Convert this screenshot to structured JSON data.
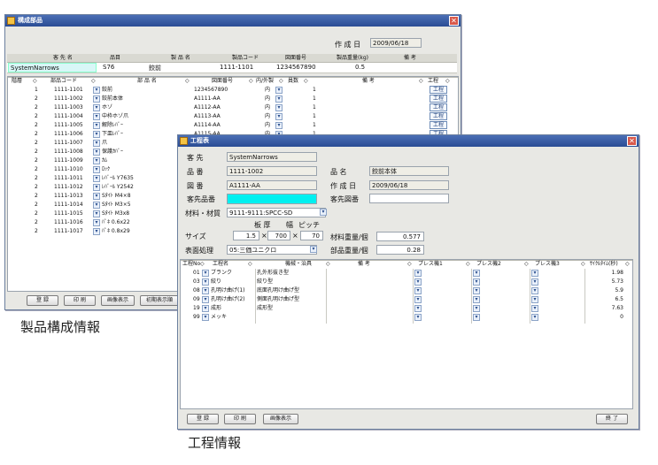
{
  "product_window": {
    "title": "構成部品",
    "created_label": "作 成 日",
    "created_date": "2009/06/18",
    "header_cols": [
      "客 先 名",
      "品目",
      "製 品 名",
      "製品コード",
      "図面番号",
      "製品重量(kg)",
      "備  考"
    ],
    "header_values": {
      "customer": "SystemNarrows",
      "item": "S76",
      "product_name": "鉸前",
      "product_code": "1111-1101",
      "drawing_no": "1234567890",
      "weight": "0.5"
    },
    "table_cols": [
      "階層",
      "部品コード",
      "部 品 名",
      "図面番号",
      "内/外製",
      "員数",
      "備  考",
      "工程"
    ],
    "rows": [
      {
        "level": "1",
        "code": "1111-1101",
        "name": "鉸前",
        "drawing": "1234567890",
        "inout": "内",
        "qty": "1",
        "btn": "工程"
      },
      {
        "level": "2",
        "code": "1111-1002",
        "name": "鉸前本体",
        "drawing": "A1111-AA",
        "inout": "内",
        "qty": "1",
        "btn": "工程"
      },
      {
        "level": "2",
        "code": "1111-1003",
        "name": "ホゾ",
        "drawing": "A1112-AA",
        "inout": "内",
        "qty": "1",
        "btn": "工程"
      },
      {
        "level": "2",
        "code": "1111-1004",
        "name": "中枠ホゾ爪",
        "drawing": "A1113-AA",
        "inout": "内",
        "qty": "1",
        "btn": "工程"
      },
      {
        "level": "2",
        "code": "1111-1005",
        "name": "解除ﾚﾊﾞｰ",
        "drawing": "A1114-AA",
        "inout": "内",
        "qty": "1",
        "btn": "工程"
      },
      {
        "level": "2",
        "code": "1111-1006",
        "name": "下皿ﾚﾊﾞｰ",
        "drawing": "A1115-AA",
        "inout": "内",
        "qty": "1",
        "btn": "工程"
      },
      {
        "level": "2",
        "code": "1111-1007",
        "name": "爪",
        "drawing": "",
        "inout": "",
        "qty": "",
        "btn": ""
      },
      {
        "level": "2",
        "code": "1111-1008",
        "name": "保護ｶﾊﾞｰ",
        "drawing": "",
        "inout": "",
        "qty": "",
        "btn": ""
      },
      {
        "level": "2",
        "code": "1111-1009",
        "name": "ｶﾑ",
        "drawing": "",
        "inout": "",
        "qty": "",
        "btn": ""
      },
      {
        "level": "2",
        "code": "1111-1010",
        "name": "ﾛｯｸ",
        "drawing": "",
        "inout": "",
        "qty": "",
        "btn": ""
      },
      {
        "level": "2",
        "code": "1111-1011",
        "name": "ﾚﾊﾞｰﾙ Y7635",
        "drawing": "",
        "inout": "",
        "qty": "",
        "btn": ""
      },
      {
        "level": "2",
        "code": "1111-1012",
        "name": "ﾚﾊﾞｰﾙ Y2542",
        "drawing": "",
        "inout": "",
        "qty": "",
        "btn": ""
      },
      {
        "level": "2",
        "code": "1111-1013",
        "name": "Sﾀｲﾄ M4×8",
        "drawing": "",
        "inout": "",
        "qty": "",
        "btn": ""
      },
      {
        "level": "2",
        "code": "1111-1014",
        "name": "Sﾀｲﾄ M3×5",
        "drawing": "",
        "inout": "",
        "qty": "",
        "btn": ""
      },
      {
        "level": "2",
        "code": "1111-1015",
        "name": "Sﾀｲﾄ M3x8",
        "drawing": "",
        "inout": "",
        "qty": "",
        "btn": ""
      },
      {
        "level": "2",
        "code": "1111-1016",
        "name": "ﾊﾟﾈ 0.6x22",
        "drawing": "",
        "inout": "",
        "qty": "",
        "btn": ""
      },
      {
        "level": "2",
        "code": "1111-1017",
        "name": "ﾊﾟﾈ 0.8x29",
        "drawing": "",
        "inout": "",
        "qty": "",
        "btn": ""
      }
    ],
    "buttons": {
      "register": "登 録",
      "print": "印 刷",
      "image": "画像表示",
      "initial": "初期表示順"
    }
  },
  "product_caption": "製品構成情報",
  "process_window": {
    "title": "工程表",
    "labels": {
      "customer": "客  先",
      "part_no": "品  番",
      "drawing": "図  番",
      "cust_part": "客先品番",
      "material": "材料・材質",
      "size": "サイズ",
      "surface": "表面処理",
      "name": "品  名",
      "created": "作 成 日",
      "cust_drawing": "客先図番",
      "mat_weight": "材料重量/個",
      "part_weight": "部品重量/個",
      "thickness": "板  厚",
      "width": "幅",
      "pitch": "ピッチ"
    },
    "values": {
      "customer": "SystemNarrows",
      "part_no": "1111-1002",
      "drawing": "A1111-AA",
      "cust_part": "",
      "material": "9111-9111:SPCC-SD",
      "thickness": "1.5",
      "width": "700",
      "pitch": "70",
      "surface": "05:三価ユニクロ",
      "name": "鉸前本体",
      "created": "2009/06/18",
      "cust_drawing": "",
      "mat_weight": "0.577",
      "part_weight": "0.28"
    },
    "times": "×",
    "table_cols": [
      "工程No",
      "工程名",
      "機械・治具",
      "備  考",
      "プレス機1",
      "プレス機2",
      "プレス機3",
      "ｻｲｸﾙﾀｲﾑ(秒)"
    ],
    "rows": [
      {
        "no": "01",
        "name": "ブランク",
        "machine": "孔外形抜き型",
        "time": "1.98"
      },
      {
        "no": "03",
        "name": "絞り",
        "machine": "絞り型",
        "time": "5.73"
      },
      {
        "no": "08",
        "name": "孔明け曲げ(1)",
        "machine": "底面孔明け曲げ型",
        "time": "5.9"
      },
      {
        "no": "09",
        "name": "孔明け曲げ(2)",
        "machine": "側面孔明け曲げ型",
        "time": "6.5"
      },
      {
        "no": "19",
        "name": "成形",
        "machine": "成形型",
        "time": "7.63"
      },
      {
        "no": "99",
        "name": "メッキ",
        "machine": "",
        "time": "0"
      }
    ],
    "buttons": {
      "register": "登 録",
      "print": "印 刷",
      "image": "画像表示",
      "close": "終 了"
    }
  },
  "process_caption": "工程情報"
}
